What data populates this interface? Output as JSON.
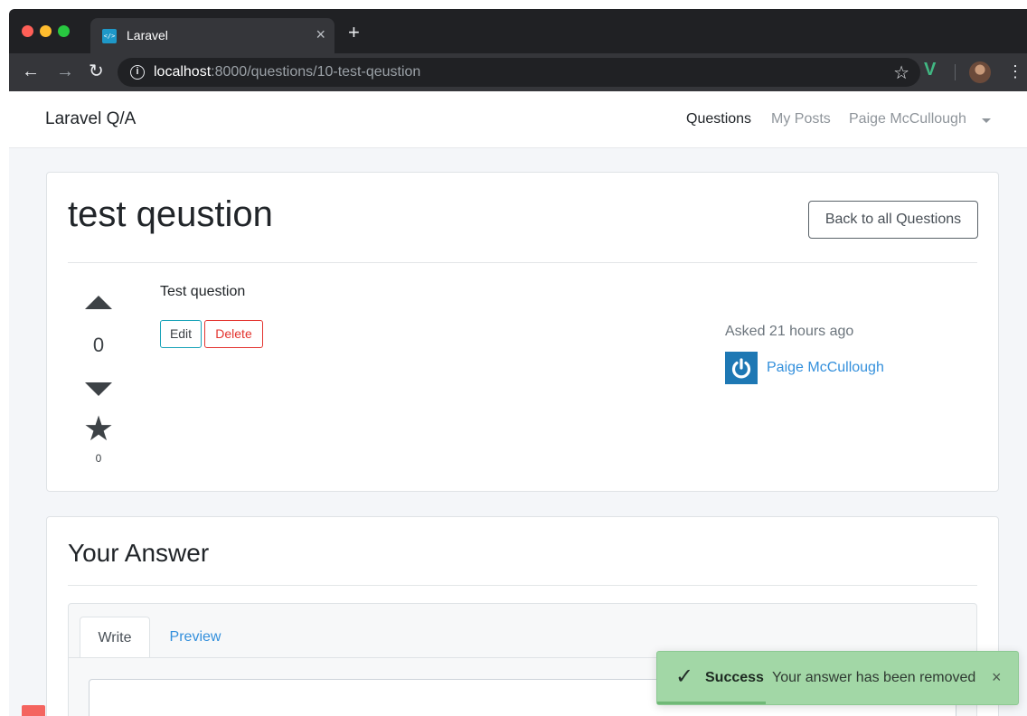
{
  "browser": {
    "tab_title": "Laravel",
    "tab_favicon": "</>",
    "tab_close": "×",
    "new_tab": "+",
    "back": "←",
    "forward": "→",
    "reload": "↻",
    "info": "i",
    "url_host": "localhost",
    "url_rest": ":8000/questions/10-test-qeustion",
    "bookmark": "☆",
    "extension": "V",
    "menu": "⋮"
  },
  "navbar": {
    "brand": "Laravel Q/A",
    "links": [
      "Questions",
      "My Posts",
      "Paige McCullough"
    ]
  },
  "question": {
    "title": "test qeustion",
    "back_label": "Back to all Questions",
    "body": "Test question",
    "edit_label": "Edit",
    "delete_label": "Delete",
    "votes": "0",
    "favorites": "0",
    "favorite_icon": "★",
    "asked": "Asked 21 hours ago",
    "author": "Paige McCullough"
  },
  "answer": {
    "title": "Your Answer",
    "tabs": [
      "Write",
      "Preview"
    ]
  },
  "toast": {
    "check": "✓",
    "title": "Success",
    "message": "Your answer has been removed",
    "close": "×",
    "progress": 0.3
  },
  "colors": {
    "accent": "#3490dc",
    "danger": "#e3342f",
    "info": "#17a2b8",
    "success_toast": "#a2d7a6"
  }
}
